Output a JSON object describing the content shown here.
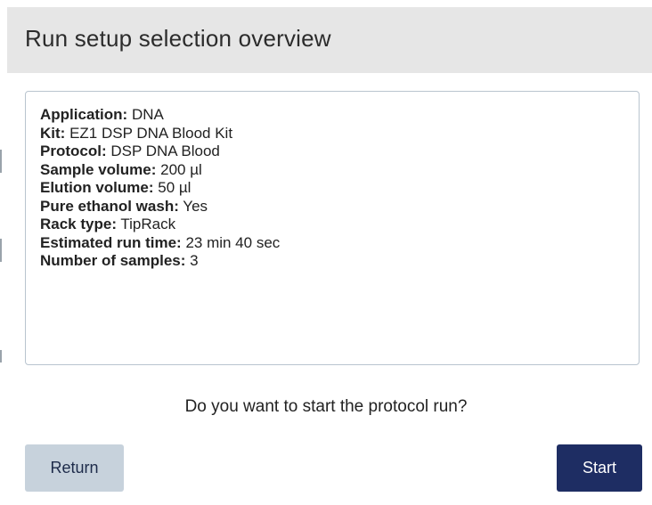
{
  "dialog": {
    "title": "Run setup selection overview"
  },
  "summary": {
    "rows": [
      {
        "label": "Application:",
        "value": "DNA"
      },
      {
        "label": "Kit:",
        "value": "EZ1 DSP DNA Blood Kit"
      },
      {
        "label": "Protocol:",
        "value": "DSP DNA Blood"
      },
      {
        "label": "Sample volume:",
        "value": "200 µl"
      },
      {
        "label": "Elution volume:",
        "value": "50 µl"
      },
      {
        "label": "Pure ethanol wash:",
        "value": "Yes"
      },
      {
        "label": "Rack type:",
        "value": "TipRack"
      },
      {
        "label": "Estimated run time:",
        "value": "23 min 40 sec"
      },
      {
        "label": "Number of samples:",
        "value": "3"
      }
    ]
  },
  "prompt": {
    "question": "Do you want to start the protocol run?"
  },
  "actions": {
    "return_label": "Return",
    "start_label": "Start"
  },
  "colors": {
    "header_bg": "#e6e6e6",
    "return_button_bg": "#c7d2dc",
    "start_button_bg": "#1e2d63",
    "box_border": "#b9c4cf"
  }
}
